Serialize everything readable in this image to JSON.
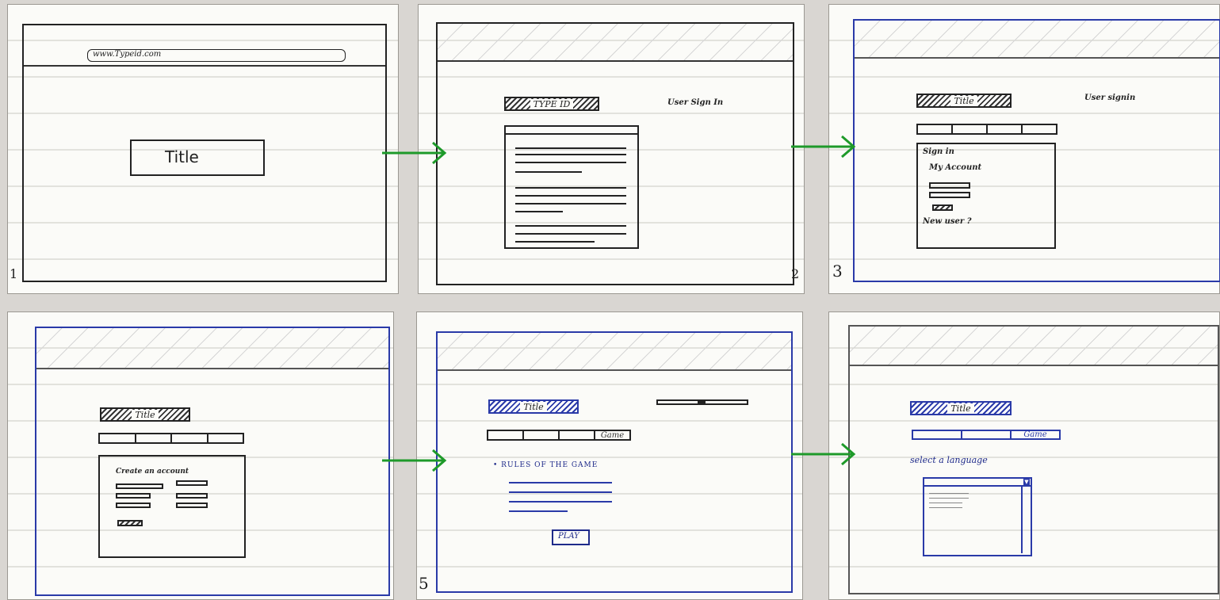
{
  "colors": {
    "arrow": "#1e9a2a",
    "ink": "#222222",
    "blue_ink": "#2a3aa8"
  },
  "screens": [
    {
      "number": "1",
      "url": "www.Typeid.com",
      "title": "Title"
    },
    {
      "number": "2",
      "logo": "TYPE ID",
      "link": "User Sign In"
    },
    {
      "number": "3",
      "logo": "Title",
      "link": "User signin",
      "form_title": "Sign in",
      "account_label": "My Account",
      "new_user": "New user ?"
    },
    {
      "logo": "Title",
      "form_title": "Create an account"
    },
    {
      "number": "5",
      "logo": "Title",
      "tab_game": "Game",
      "rules_heading": "• RULES OF THE GAME",
      "play_button": "PLAY"
    },
    {
      "logo": "Title",
      "tab_game": "Game",
      "select_label": "select a language"
    }
  ],
  "arrows": [
    {
      "from": "screen-1",
      "to": "screen-2"
    },
    {
      "from": "screen-2",
      "to": "screen-3"
    },
    {
      "from": "screen-4",
      "to": "screen-5"
    },
    {
      "from": "screen-5",
      "to": "screen-6"
    }
  ]
}
